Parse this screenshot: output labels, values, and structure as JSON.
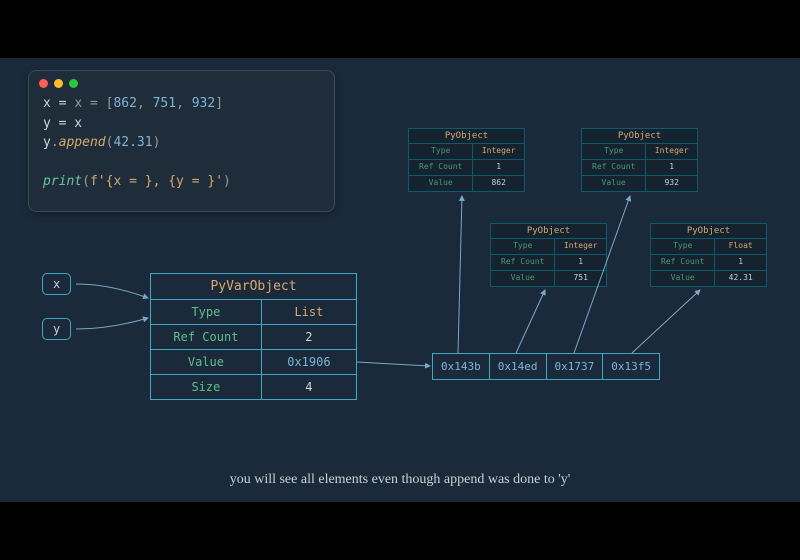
{
  "code": {
    "line1_prefix": "x = [",
    "line1_nums": [
      "862",
      "751",
      "932"
    ],
    "line1_suffix": "]",
    "line2": "y = x",
    "line3_obj": "y",
    "line3_method": "append",
    "line3_arg": "42.31",
    "line4_func": "print",
    "line4_str": "f'{x = }, {y = }'"
  },
  "vars": {
    "x": "x",
    "y": "y"
  },
  "pyvar": {
    "title": "PyVarObject",
    "rows": [
      {
        "label": "Type",
        "value": "List",
        "cls": "orange"
      },
      {
        "label": "Ref Count",
        "value": "2",
        "cls": ""
      },
      {
        "label": "Value",
        "value": "0x1906",
        "cls": "blue"
      },
      {
        "label": "Size",
        "value": "4",
        "cls": ""
      }
    ]
  },
  "array": [
    "0x143b",
    "0x14ed",
    "0x1737",
    "0x13f5"
  ],
  "small_objects": [
    {
      "title": "PyObject",
      "type": "Integer",
      "refcount": "1",
      "value": "862"
    },
    {
      "title": "PyObject",
      "type": "Integer",
      "refcount": "1",
      "value": "751"
    },
    {
      "title": "PyObject",
      "type": "Integer",
      "refcount": "1",
      "value": "932"
    },
    {
      "title": "PyObject",
      "type": "Float",
      "refcount": "1",
      "value": "42.31"
    }
  ],
  "small_row_labels": {
    "type": "Type",
    "refcount": "Ref Count",
    "value": "Value"
  },
  "caption": "you will see all elements even though append was done to 'y'"
}
